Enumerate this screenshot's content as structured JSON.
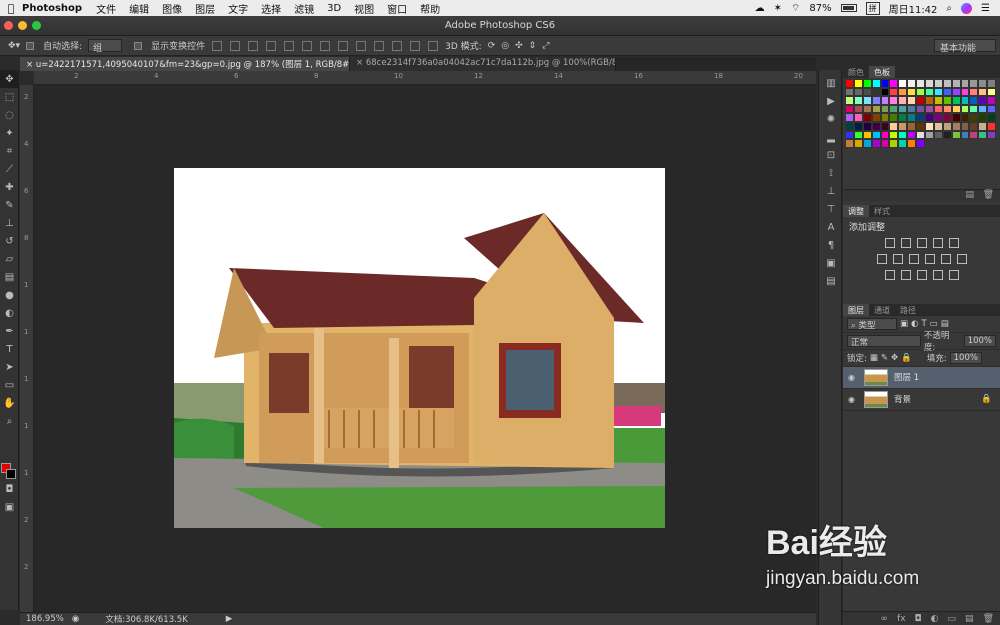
{
  "menubar": {
    "apple": "",
    "app": "Photoshop",
    "items": [
      "文件",
      "编辑",
      "图像",
      "图层",
      "文字",
      "选择",
      "滤镜",
      "3D",
      "视图",
      "窗口",
      "帮助"
    ],
    "battery": "87%",
    "input_method": "拼",
    "clock": "周日11:42"
  },
  "window": {
    "title": "Adobe Photoshop CS6"
  },
  "options": {
    "auto_select_label": "自动选择:",
    "auto_select_value": "组",
    "show_transform_label": "显示变换控件",
    "mode_3d_label": "3D 模式:",
    "workspace": "基本功能"
  },
  "tabs": [
    {
      "label": "u=2422171571,4095040107&fm=23&gp=0.jpg @ 187% (图层 1, RGB/8#) *",
      "close": "×"
    },
    {
      "label": "68ce2314f736a0a04042ac71c7da112b.jpg @ 100%(RGB/8#) *",
      "close": "×"
    }
  ],
  "rulers": {
    "h": [
      "",
      "2",
      "",
      "4",
      "",
      "6",
      "",
      "8",
      "",
      "10",
      "",
      "12",
      "",
      "14",
      "",
      "16",
      "",
      "18",
      "",
      "20"
    ],
    "v": [
      "2",
      "4",
      "6",
      "8",
      "1",
      "1",
      "1",
      "1",
      "1",
      "2",
      "2"
    ]
  },
  "status": {
    "zoom": "186.95%",
    "doc": "文档:306.8K/613.5K"
  },
  "panels": {
    "color_tabs": [
      "颜色",
      "色板"
    ],
    "adjust_tabs": [
      "调整",
      "样式"
    ],
    "adjust_heading": "添加调整",
    "layer_tabs": [
      "图层",
      "通道",
      "路径"
    ],
    "kind": "类型",
    "blend": "正常",
    "opacity_label": "不透明度:",
    "opacity": "100%",
    "lock_label": "锁定:",
    "fill_label": "填充:",
    "fill": "100%",
    "layers": [
      {
        "name": "图层 1",
        "selected": true
      },
      {
        "name": "背景",
        "selected": false
      }
    ]
  },
  "watermark": {
    "brand": "Bai经验",
    "url": "jingyan.baidu.com"
  },
  "swatch_colors": [
    "#ff0000",
    "#ffff00",
    "#00ff00",
    "#00ffff",
    "#0000ff",
    "#ff00ff",
    "#ffffff",
    "#f2f2f2",
    "#e6e6e6",
    "#d9d9d9",
    "#cccccc",
    "#bfbfbf",
    "#b3b3b3",
    "#a6a6a6",
    "#999999",
    "#8c8c8c",
    "#808080",
    "#737373",
    "#666666",
    "#4d4d4d",
    "#333333",
    "#000000",
    "#ff4040",
    "#ff9a40",
    "#ffe040",
    "#9aff40",
    "#40ff9a",
    "#40e0ff",
    "#4060ff",
    "#9a40ff",
    "#ff40e0",
    "#ff8080",
    "#ffc080",
    "#ffff80",
    "#c0ff80",
    "#80ffc0",
    "#80e0ff",
    "#8080ff",
    "#c080ff",
    "#ff80e0",
    "#ffb0b0",
    "#ffd8b0",
    "#c00000",
    "#c06000",
    "#c0c000",
    "#60c000",
    "#00c060",
    "#00c0c0",
    "#0060c0",
    "#6000c0",
    "#c000c0",
    "#e00060",
    "#a05050",
    "#a07850",
    "#a0a050",
    "#78a050",
    "#50a078",
    "#50a0a0",
    "#5078a0",
    "#7850a0",
    "#a050a0",
    "#ff6060",
    "#ff9060",
    "#ffd060",
    "#b0ff60",
    "#60ffb0",
    "#60b0ff",
    "#6060ff",
    "#b060ff",
    "#ff60b0",
    "#800000",
    "#804000",
    "#808000",
    "#408000",
    "#008040",
    "#008080",
    "#004080",
    "#400080",
    "#800080",
    "#800040",
    "#400000",
    "#402000",
    "#404000",
    "#204000",
    "#004020",
    "#004040",
    "#002040",
    "#200040",
    "#400040",
    "#400020",
    "#ffcc99",
    "#cc9966",
    "#996633",
    "#663300",
    "#ffe0c0",
    "#e0c0a0",
    "#c0a080",
    "#a08060",
    "#806040",
    "#604020",
    "#c8b090",
    "#ff3030",
    "#3030ff",
    "#30ff30",
    "#ffc000",
    "#00c0ff",
    "#ff00c0",
    "#c0ff00",
    "#00ffc0",
    "#c000ff",
    "#e0e0e0",
    "#a0a0a0",
    "#606060",
    "#202020",
    "#7fbf3f",
    "#3f7fbf",
    "#bf3f7f",
    "#3fbf7f",
    "#7f3fbf",
    "#bf7f3f",
    "#d4aa00",
    "#00aad4",
    "#aa00d4",
    "#d400aa",
    "#aad400",
    "#00d4aa",
    "#ff8000",
    "#8000ff"
  ]
}
